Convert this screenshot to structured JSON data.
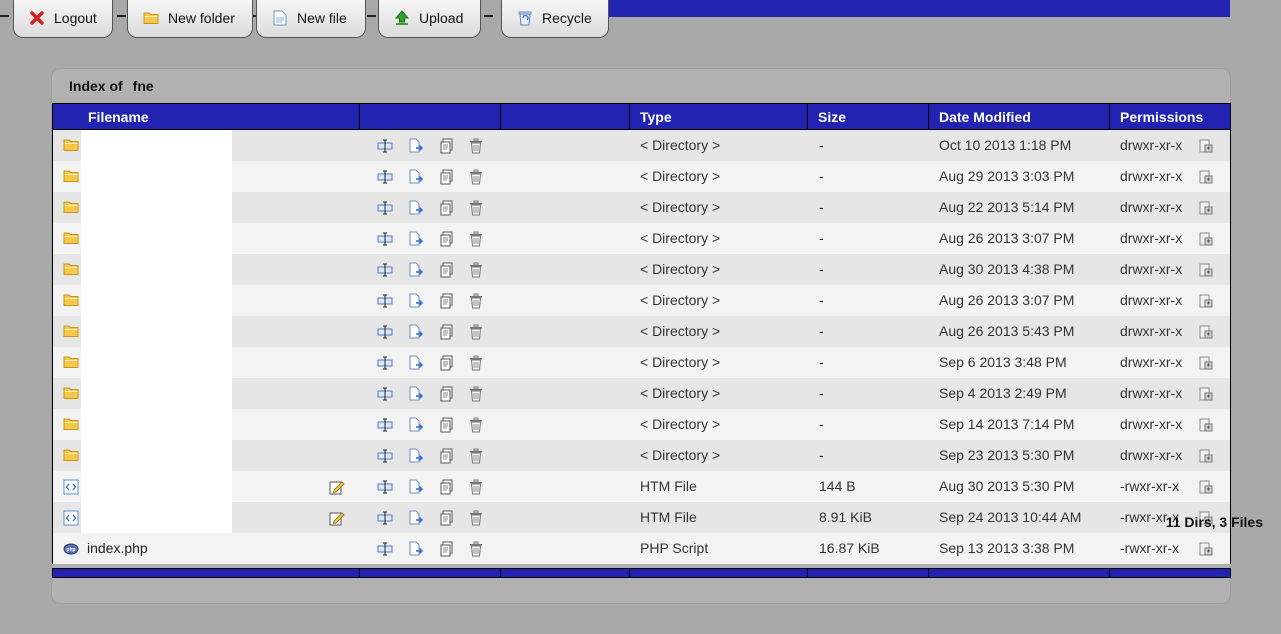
{
  "toolbar": {
    "logout_label": "Logout",
    "new_folder_label": "New folder",
    "new_file_label": "New file",
    "upload_label": "Upload",
    "recycle_label": "Recycle"
  },
  "index": {
    "prefix": "Index of",
    "dir": "fne"
  },
  "columns": {
    "filename": "Filename",
    "type": "Type",
    "size": "Size",
    "date": "Date Modified",
    "permissions": "Permissions"
  },
  "rows": [
    {
      "icon": "folder-icon",
      "name": "",
      "type": "< Directory >",
      "size": "-",
      "date": "Oct 10 2013 1:18 PM",
      "perm": "drwxr-xr-x"
    },
    {
      "icon": "folder-icon",
      "name": "",
      "type": "< Directory >",
      "size": "-",
      "date": "Aug 29 2013 3:03 PM",
      "perm": "drwxr-xr-x"
    },
    {
      "icon": "folder-icon",
      "name": "",
      "type": "< Directory >",
      "size": "-",
      "date": "Aug 22 2013 5:14 PM",
      "perm": "drwxr-xr-x"
    },
    {
      "icon": "folder-icon",
      "name": "",
      "type": "< Directory >",
      "size": "-",
      "date": "Aug 26 2013 3:07 PM",
      "perm": "drwxr-xr-x"
    },
    {
      "icon": "folder-icon",
      "name": "",
      "type": "< Directory >",
      "size": "-",
      "date": "Aug 30 2013 4:38 PM",
      "perm": "drwxr-xr-x"
    },
    {
      "icon": "folder-icon",
      "name": "",
      "type": "< Directory >",
      "size": "-",
      "date": "Aug 26 2013 3:07 PM",
      "perm": "drwxr-xr-x"
    },
    {
      "icon": "folder-icon",
      "name": "",
      "type": "< Directory >",
      "size": "-",
      "date": "Aug 26 2013 5:43 PM",
      "perm": "drwxr-xr-x"
    },
    {
      "icon": "folder-icon",
      "name": "",
      "type": "< Directory >",
      "size": "-",
      "date": "Sep 6 2013 3:48 PM",
      "perm": "drwxr-xr-x"
    },
    {
      "icon": "folder-icon",
      "name": "",
      "type": "< Directory >",
      "size": "-",
      "date": "Sep 4 2013 2:49 PM",
      "perm": "drwxr-xr-x"
    },
    {
      "icon": "folder-icon",
      "name": "",
      "type": "< Directory >",
      "size": "-",
      "date": "Sep 14 2013 7:14 PM",
      "perm": "drwxr-xr-x"
    },
    {
      "icon": "folder-icon",
      "name": "",
      "type": "< Directory >",
      "size": "-",
      "date": "Sep 23 2013 5:30 PM",
      "perm": "drwxr-xr-x"
    },
    {
      "icon": "html-file-icon",
      "name": "",
      "type": "HTM File",
      "size": "144 B",
      "date": "Aug 30 2013 5:30 PM",
      "perm": "-rwxr-xr-x",
      "editable": true
    },
    {
      "icon": "html-file-icon",
      "name": "",
      "type": "HTM File",
      "size": "8.91 KiB",
      "date": "Sep 24 2013 10:44 AM",
      "perm": "-rwxr-xr-x",
      "editable": true
    },
    {
      "icon": "php-file-icon",
      "name": "index.php",
      "type": "PHP Script",
      "size": "16.87 KiB",
      "date": "Sep 13 2013 3:38 PM",
      "perm": "-rwxr-xr-x"
    }
  ],
  "status": {
    "summary": "11 Dirs, 3 Files"
  },
  "colors": {
    "header_blue": "#2323b2",
    "background": "#a9a9a9",
    "row_odd": "#e6e6e6",
    "row_even": "#f3f3f3"
  }
}
